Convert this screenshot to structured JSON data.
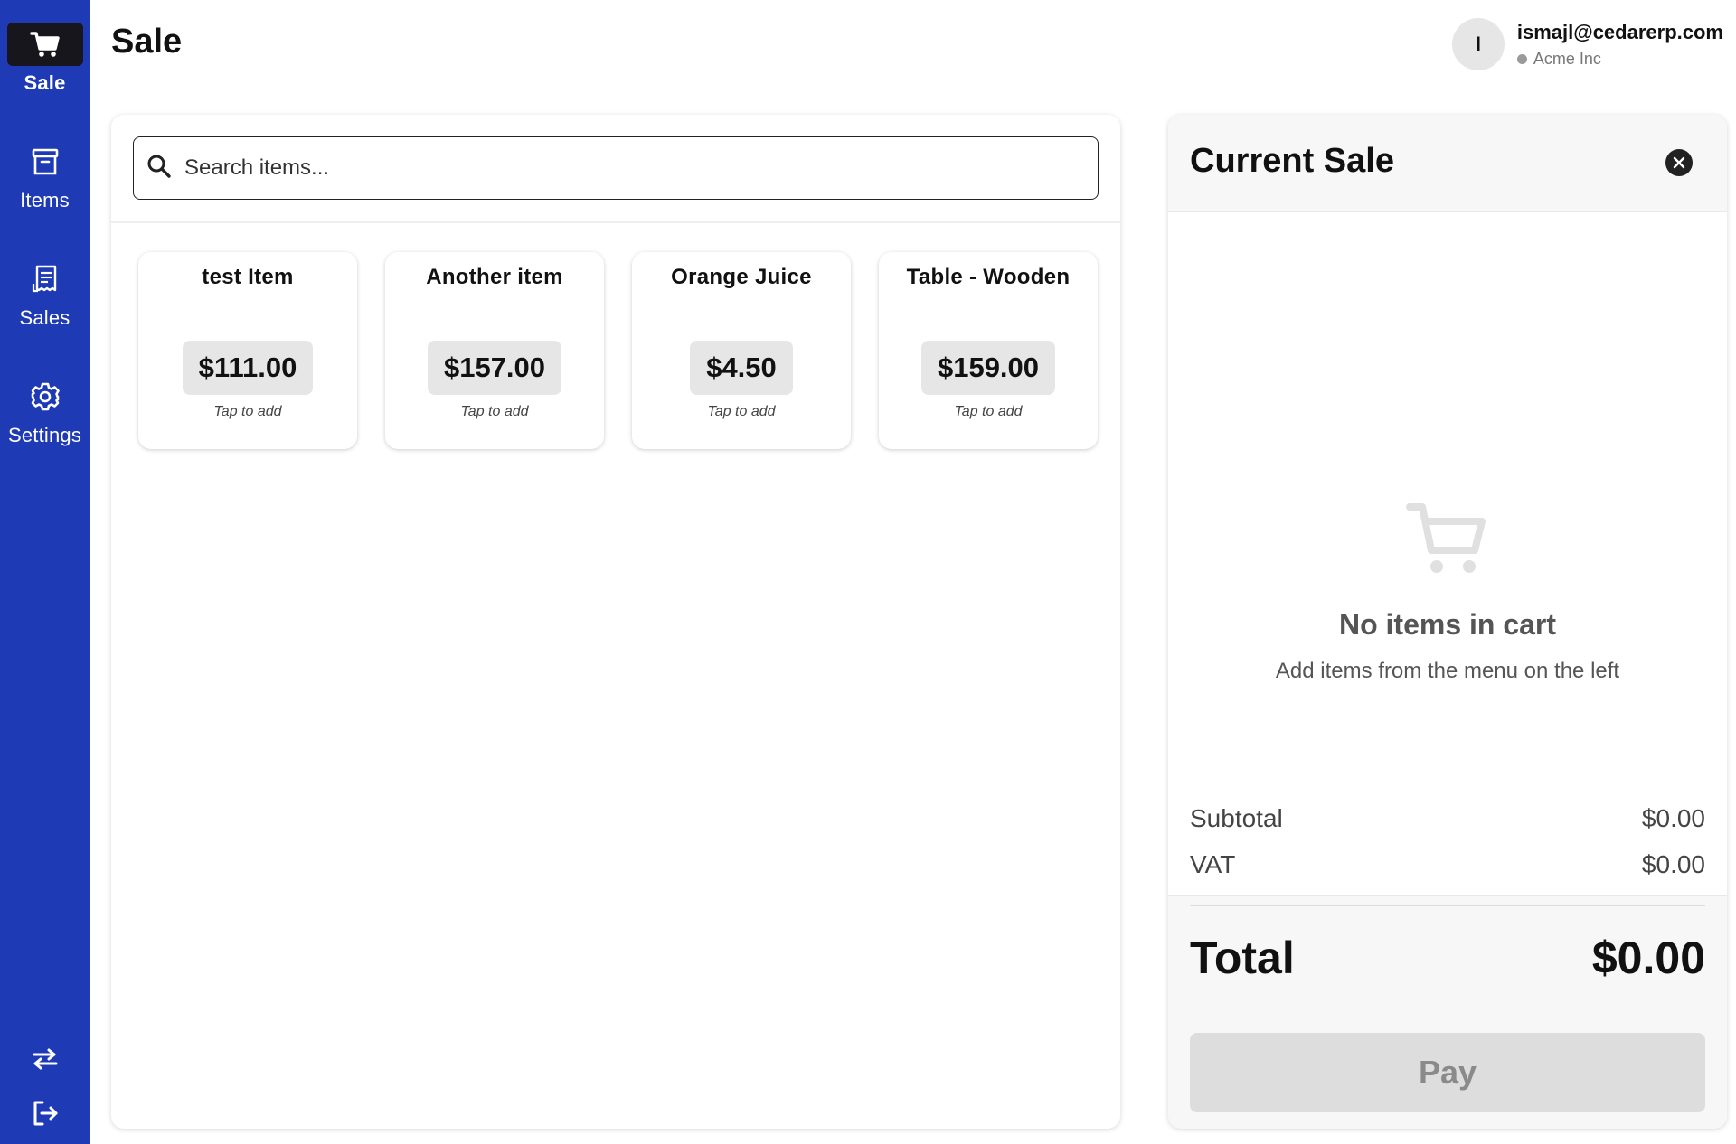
{
  "sidebar": {
    "items": [
      {
        "label": "Sale",
        "icon": "cart-icon",
        "active": true
      },
      {
        "label": "Items",
        "icon": "archive-box-icon",
        "active": false
      },
      {
        "label": "Sales",
        "icon": "receipt-icon",
        "active": false
      },
      {
        "label": "Settings",
        "icon": "gear-icon",
        "active": false
      }
    ],
    "bottom_icons": [
      "swap-arrows-icon",
      "logout-icon"
    ],
    "background_color": "#1e3ab5",
    "active_color": "#16161c"
  },
  "header": {
    "title": "Sale",
    "user": {
      "initial": "I",
      "email": "ismajl@cedarerp.com",
      "organization": "Acme Inc"
    }
  },
  "search": {
    "placeholder": "Search items...",
    "value": ""
  },
  "products": [
    {
      "name": "test Item",
      "price": "$111.00",
      "hint": "Tap to add"
    },
    {
      "name": "Another item",
      "price": "$157.00",
      "hint": "Tap to add"
    },
    {
      "name": "Orange Juice",
      "price": "$4.50",
      "hint": "Tap to add"
    },
    {
      "name": "Table - Wooden",
      "price": "$159.00",
      "hint": "Tap to add"
    }
  ],
  "cart": {
    "title": "Current Sale",
    "empty_title": "No items in cart",
    "empty_subtitle": "Add items from the menu on the left",
    "subtotal_label": "Subtotal",
    "subtotal_value": "$0.00",
    "vat_label": "VAT",
    "vat_value": "$0.00",
    "total_label": "Total",
    "total_value": "$0.00",
    "pay_label": "Pay"
  }
}
